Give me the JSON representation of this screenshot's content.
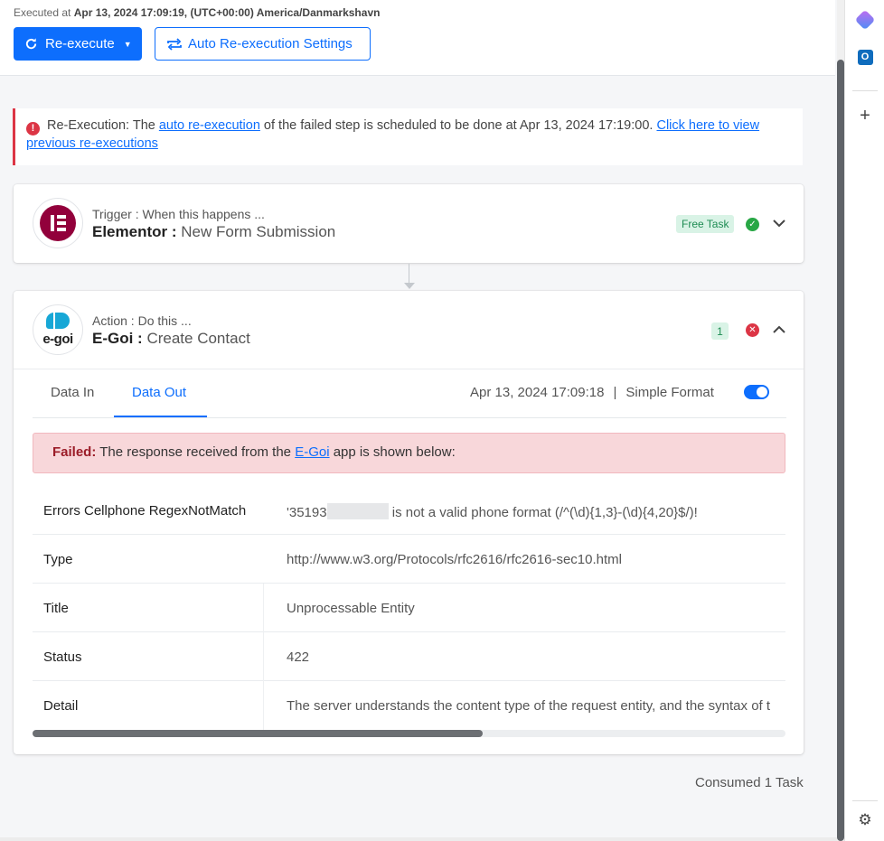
{
  "header": {
    "executed_prefix": "Executed at ",
    "executed_value": "Apr 13, 2024 17:09:19, (UTC+00:00) America/Danmarkshavn",
    "reexecute_label": "Re-execute",
    "auto_settings_label": "Auto Re-execution Settings"
  },
  "alert": {
    "prefix": "Re-Execution: The ",
    "link1": "auto re-execution",
    "middle": " of the failed step is scheduled to be done at Apr 13, 2024 17:19:00. ",
    "link2": "Click here to view previous re-executions"
  },
  "trigger": {
    "label": "Trigger : When this happens ...",
    "app": "Elementor : ",
    "event": "New Form Submission",
    "badge": "Free Task"
  },
  "action": {
    "label": "Action : Do this ...",
    "app": "E-Goi : ",
    "event": "Create Contact",
    "badge": "1",
    "logo_text": "e-goi"
  },
  "tabs": {
    "data_in": "Data In",
    "data_out": "Data Out",
    "timestamp": "Apr 13, 2024 17:09:18",
    "separator": "|",
    "simple_format": "Simple Format"
  },
  "failed": {
    "strong": "Failed:",
    "text1": " The response received from the ",
    "link": "E-Goi",
    "text2": " app is shown below:"
  },
  "rows": [
    {
      "key": "Errors Cellphone RegexNotMatch",
      "value_prefix": "'35193",
      "value_suffix": " is not a valid phone format (/^(\\d){1,3}-(\\d){4,20}$/)!"
    },
    {
      "key": "Type",
      "value": "http://www.w3.org/Protocols/rfc2616/rfc2616-sec10.html"
    },
    {
      "key": "Title",
      "value": "Unprocessable Entity"
    },
    {
      "key": "Status",
      "value": "422"
    },
    {
      "key": "Detail",
      "value": "The server understands the content type of the request entity, and the syntax of t"
    }
  ],
  "footer": {
    "consumed": "Consumed 1 Task"
  },
  "colors": {
    "primary": "#0d6efd",
    "danger": "#dc3545",
    "success": "#28a745"
  }
}
